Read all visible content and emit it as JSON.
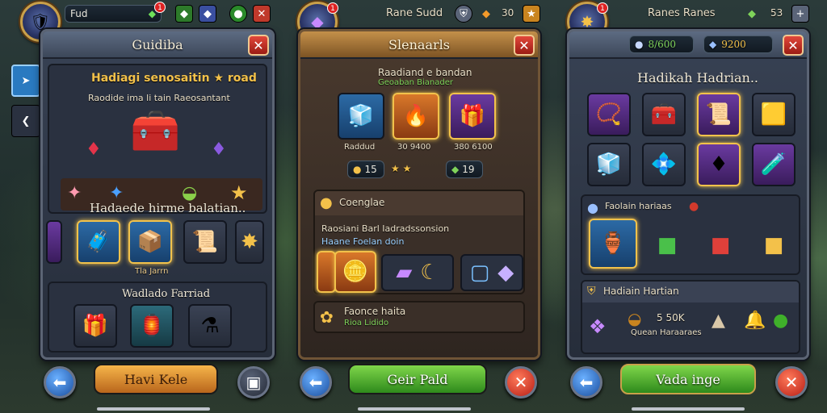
{
  "colors": {
    "accent_gold": "#f3c14a",
    "close_red": "#d33a2c",
    "green": "#3fa52a",
    "blue": "#2c6aa5"
  },
  "panels": [
    {
      "topbar": {
        "name": "Fud",
        "badge": "1"
      },
      "title": "Guidiba",
      "section1": {
        "heading": "Hadiagi senosaitin ★ road",
        "sub": "Raodide ima li tain Raeosantant"
      },
      "section2": {
        "heading": "Hadaede hirme balatian..",
        "caption": "Tla Jarrn"
      },
      "section3": {
        "heading": "Wadlado Farriad"
      },
      "button": "Havi Kele"
    },
    {
      "topbar": {
        "name": "Rane Sudd",
        "badge": "1",
        "count": "30"
      },
      "title": "Slenaarls",
      "section1": {
        "heading": "Raadiand e bandan",
        "sub": "Geoaban Bianader",
        "cards": [
          {
            "label": "Raddud"
          },
          {
            "label": "30 9400"
          },
          {
            "label": "380 6100"
          }
        ],
        "stats": [
          "15",
          "★ ★",
          "19"
        ]
      },
      "section2": {
        "heading": "Coenglae",
        "line1": "Raosiani Barl Iadradssonsion",
        "line2": "Haane Foelan doin"
      },
      "section3": {
        "heading": "Faonce haita",
        "sub": "Rioa Lidido"
      },
      "button": "Geir Pald"
    },
    {
      "topbar": {
        "name": "Ranes Ranes",
        "badge": "1",
        "count": "53",
        "res1": "8/600",
        "res2": "9200"
      },
      "title": "Hadikah Hadrian..",
      "section2": {
        "heading": "Faolain hariaas"
      },
      "section3": {
        "heading": "Hadiain Hartian",
        "value": "5 50K",
        "sub": "Quean Haraaraes"
      },
      "button": "Vada inge"
    }
  ]
}
